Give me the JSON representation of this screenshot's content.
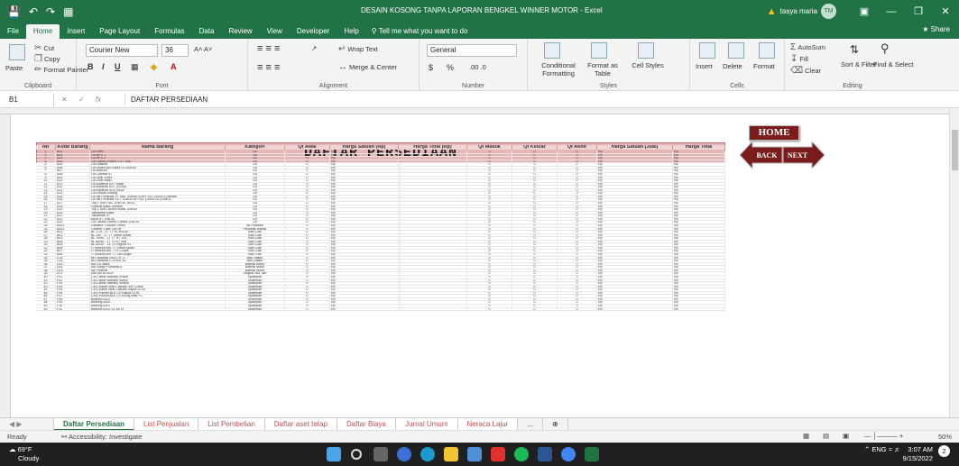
{
  "window": {
    "title": "DESAIN KOSONG TANPA  LAPORAN BENGKEL WINNER MOTOR  -  Excel",
    "user_name": "tasya maria",
    "user_initials": "TM",
    "share": "Share"
  },
  "ribbon_tabs": [
    "File",
    "Home",
    "Insert",
    "Page Layout",
    "Formulas",
    "Data",
    "Review",
    "View",
    "Developer",
    "Help"
  ],
  "tell_me": "Tell me what you want to do",
  "ribbon": {
    "clipboard": {
      "cut": "Cut",
      "copy": "Copy",
      "paste": "Paste",
      "format_painter": "Format Painter",
      "label": "Clipboard"
    },
    "font": {
      "name": "Courier New",
      "size": "36",
      "label": "Font"
    },
    "alignment": {
      "wrap": "Wrap Text",
      "merge": "Merge & Center",
      "label": "Alignment"
    },
    "number": {
      "format": "General",
      "label": "Number",
      "currency": "$",
      "percent": "%"
    },
    "styles": {
      "conditional": "Conditional Formatting",
      "format_table": "Format as Table",
      "cell_styles": "Cell Styles",
      "label": "Styles"
    },
    "cells": {
      "insert": "Insert",
      "delete": "Delete",
      "format": "Format",
      "label": "Cells"
    },
    "editing": {
      "autosum": "AutoSum",
      "fill": "Fill",
      "clear": "Clear",
      "sort": "Sort & Filter",
      "find": "Find & Select",
      "label": "Editing"
    }
  },
  "formula_bar": {
    "cell": "B1",
    "value": "DAFTAR PERSEDIAAN"
  },
  "sheet": {
    "title": "DAFTAR PERSEDIAAN",
    "headers": [
      "No",
      "Kode Barang",
      "Nama Barang",
      "Kategori",
      "Qt Awal",
      "Harga Satuan (Rp)",
      "Harga Total (Rp)",
      "Qt Masuk",
      "Qt Keluar",
      "Qt Akhir",
      "Harga Satuan (Jual)",
      "Harga Total"
    ],
    "rows": [
      [
        "1",
        "A01",
        "Oli Shell",
        "Oli"
      ],
      [
        "2",
        "A02",
        "Oli MPX 1",
        "Oli"
      ],
      [
        "3",
        "A03",
        "Oli MPX 2",
        "Oli"
      ],
      [
        "4",
        "A04",
        "Oli Castrol Power 1 4T 10w",
        "Oli"
      ],
      [
        "5",
        "A05",
        "Oli Evalube",
        "Oli"
      ],
      [
        "6",
        "A06",
        "Oli United Mil Super F4 20w/50",
        "Oli"
      ],
      [
        "7",
        "A07",
        "Oli Motrum",
        "Oli"
      ],
      [
        "8",
        "A08",
        "Oli Combat 4T",
        "Oli"
      ],
      [
        "9",
        "A09",
        "Oli Gear 10ltre",
        "Oli"
      ],
      [
        "10",
        "A10",
        "Oli Gear Matic",
        "Oli"
      ],
      [
        "11",
        "A11",
        "Oli Advance AX7 Matic",
        "Oli"
      ],
      [
        "12",
        "A12",
        "Oli Advance AX7 (20/40)",
        "Oli"
      ],
      [
        "13",
        "A13",
        "Oli Advance AX5 (0/40)",
        "Oli"
      ],
      [
        "14",
        "A14",
        "Oli Enduro Racing",
        "Oli"
      ],
      [
        "15",
        "A15",
        "Oli Val Fortitude 4T SAE 20W50 & API SG (2400L/1L)Bottle",
        "Oli"
      ],
      [
        "16",
        "A16",
        "Oli Val Fortitude SCT 10W30 API SG (2400L/1L)Gear A",
        "Oli"
      ],
      [
        "17",
        "A17",
        "Top 1 SMO MC 20W-50 JASO",
        "Oli"
      ],
      [
        "18",
        "A18",
        "Federal Matic Ultratec",
        "Oli"
      ],
      [
        "19",
        "A19",
        "Top 1 SMO Action Matic 10W30",
        "Oli"
      ],
      [
        "20",
        "A20",
        "Yamalube Matic",
        "Oli"
      ],
      [
        "21",
        "A21",
        "Yamalube 4T",
        "Oli"
      ],
      [
        "22",
        "A22",
        "Aurio 4T 20w-40",
        "Oli"
      ],
      [
        "23",
        "A23",
        "Oli Castrol Power 1 Matic 10w-30",
        "Oli"
      ],
      [
        "24",
        "A001",
        "Radiator Coolant Green",
        "Air Radiator"
      ],
      [
        "25",
        "A002",
        "Cleaner Lube 300 ml",
        "Pelumas Rantai"
      ],
      [
        "26",
        "B01",
        "BL 2,25 - 17 TT KCR2030",
        "Ban Luar"
      ],
      [
        "27",
        "B02",
        "BL 250 - 17 TT Street Angel",
        "Ban Luar"
      ],
      [
        "28",
        "B03",
        "BL 70/90 - 17 TT RT 193",
        "Ban Luar"
      ],
      [
        "29",
        "B04",
        "BL 80/90 - 17 TL RT 308",
        "Ban Luar"
      ],
      [
        "30",
        "B05",
        "BL 80/90 - 14 TL Regina S1",
        "Ban Luar"
      ],
      [
        "31",
        "B06",
        "IT tubless inst TT Street Angel",
        "Ban Luar"
      ],
      [
        "32",
        "B07",
        "IT tubless inst TT K-Crane",
        "Ban Luar"
      ],
      [
        "33",
        "B08",
        "IT tubless inst TT Leili Angel",
        "Ban Luar"
      ],
      [
        "34",
        "C01",
        "BD Swallow 250/275-17",
        "Ban Dalam"
      ],
      [
        "35",
        "C02",
        "BD Swallow 275/300-14",
        "Ban Dalam"
      ],
      [
        "36",
        "D01",
        "Aki GS Astra",
        "Baterai Motor"
      ],
      [
        "37",
        "D02",
        "Aki Sonja Purnama A",
        "Baterai Motor"
      ],
      [
        "38",
        "D03",
        "Aki Federal",
        "Baterai Motor"
      ],
      [
        "39",
        "E01",
        "pair pur 83 ASP",
        "Lingkar Alur Jari"
      ],
      [
        "40",
        "F01",
        "CKD-Bear Barstep Grand",
        "Sparepart"
      ],
      [
        "41",
        "F02",
        "CKD-Bear Barstep Supra",
        "Sparepart"
      ],
      [
        "42",
        "F03",
        "CKD-Bear Barstep Smash",
        "Sparepart"
      ],
      [
        "43",
        "F04",
        "CKD-Kaset Seal Cakram JUP-Z/Mio",
        "Sparepart"
      ],
      [
        "44",
        "F05",
        "CKD-Kaset Seal Cakram Supra-X125",
        "Sparepart"
      ],
      [
        "45",
        "F06",
        "CKD-Pocket BLK LR Kaplor-CRN",
        "Sparepart"
      ],
      [
        "46",
        "F07",
        "CKD-Pocket BLK LR Kiling-New P1",
        "Sparepart"
      ],
      [
        "47",
        "F08",
        "Bearing 6201",
        "Sparepart"
      ],
      [
        "48",
        "F09",
        "Bearing 6300",
        "Sparepart"
      ],
      [
        "49",
        "F10",
        "Bearing 6301",
        "Sparepart"
      ],
      [
        "50",
        "F11",
        "Bearing 6202 ZZ MTN",
        "Sparepart"
      ]
    ],
    "zero": "0",
    "rp": "Rp",
    "dash": "-"
  },
  "nav_buttons": {
    "home": "HOME",
    "back": "BACK",
    "next": "NEXT"
  },
  "sheet_tabs": [
    "Daftar Persediaan",
    "List Penjualan",
    "List Pembelian",
    "Daftar aset tetap",
    "Daftar Biaya",
    "Jurnal Umum",
    "Neraca Lajur",
    "..."
  ],
  "status": {
    "ready": "Ready",
    "accessibility": "Accessibility: Investigate",
    "zoom": "50%"
  },
  "taskbar": {
    "temp": "69°F",
    "weather": "Cloudy",
    "lang": "ENG",
    "time": "3:07 AM",
    "date": "9/15/2022",
    "notif": "2"
  },
  "colors": {
    "excel_green": "#217346",
    "title_band": "#e8b5b7",
    "nav_dark": "#7a1c1c"
  }
}
